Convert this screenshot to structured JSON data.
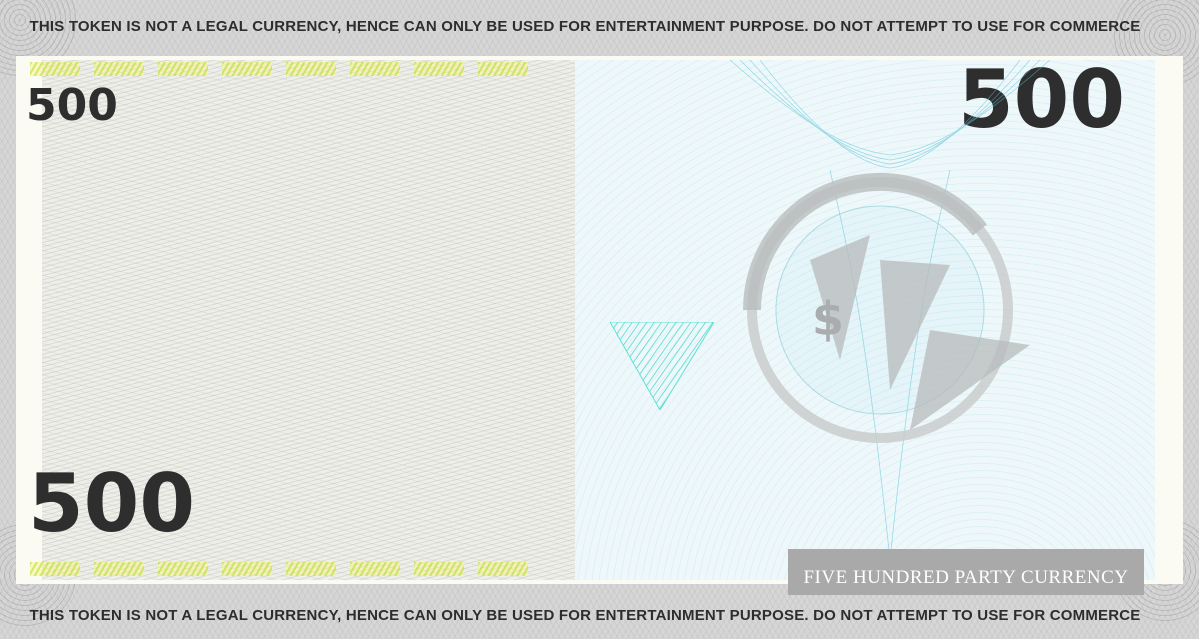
{
  "note": {
    "disclaimer_top": "THIS TOKEN IS NOT A LEGAL CURRENCY, HENCE CAN ONLY BE USED FOR ENTERTAINMENT PURPOSE. DO NOT ATTEMPT TO USE FOR COMMERCE",
    "disclaimer_bottom": "THIS TOKEN IS NOT A LEGAL CURRENCY, HENCE CAN ONLY BE USED FOR ENTERTAINMENT PURPOSE. DO NOT ATTEMPT TO USE FOR COMMERCE",
    "denomination_top_left": "500",
    "denomination_bottom_left": "500",
    "denomination_top_right": "500",
    "currency_label": "FIVE HUNDRED PARTY CURRENCY",
    "emblem_symbol": "$"
  },
  "colors": {
    "frame": "#d6d6d6",
    "left_panel": "#efefea",
    "right_panel": "#eef8fb",
    "text": "#2e2e2e",
    "teal_accent": "#3fd6c8",
    "label_box": "#a9a9a9"
  }
}
